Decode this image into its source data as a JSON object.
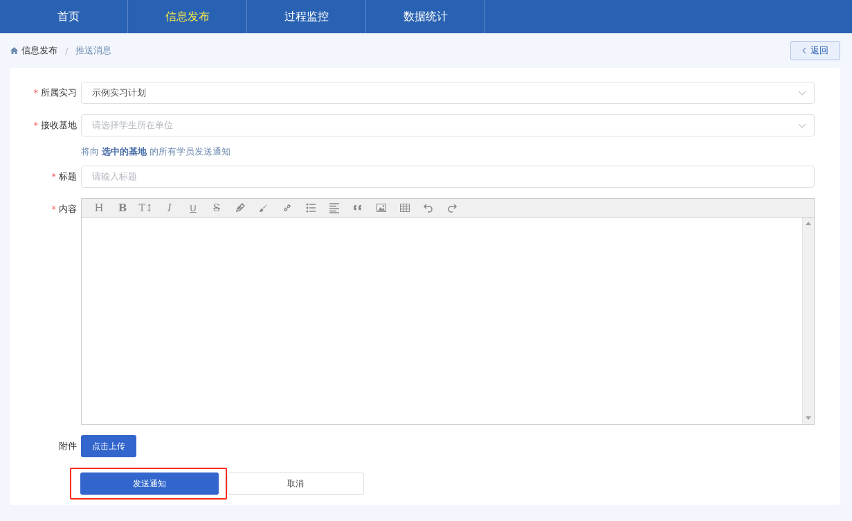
{
  "nav": [
    {
      "label": "首页",
      "selected": false
    },
    {
      "label": "信息发布",
      "selected": true
    },
    {
      "label": "过程监控",
      "selected": false
    },
    {
      "label": "数据统计",
      "selected": false
    }
  ],
  "breadcrumb": [
    "信息发布",
    "推送消息"
  ],
  "breadcrumb_separator": "/",
  "back_button": "返回",
  "form": {
    "fields": [
      {
        "label": "所属实习",
        "required_mark": "*",
        "kind": "select",
        "value": "示例实习计划"
      },
      {
        "label": "接收基地",
        "required_mark": "*",
        "kind": "select",
        "placeholder": "请选择学生所在单位",
        "hint": "将向 **选中的基地** 的所有学员发送通知"
      },
      {
        "label": "标题",
        "required_mark": "*",
        "kind": "input",
        "placeholder": "请输入标题"
      },
      {
        "label": "内容",
        "required_mark": "*",
        "kind": "editor"
      }
    ],
    "toolbar": [
      {
        "kind": "heading",
        "label": "H"
      },
      {
        "kind": "bold",
        "label": "B"
      },
      {
        "kind": "size",
        "label": "T↕"
      },
      {
        "kind": "italic",
        "label": "I"
      },
      {
        "kind": "underline",
        "label": "U"
      },
      {
        "kind": "strike",
        "label": "S"
      }
    ],
    "attachment": {
      "label": "附件",
      "button": "点击上传"
    },
    "buttons": [
      {
        "label": "发送通知",
        "kind": "primary",
        "highlighted": true
      },
      {
        "label": "取消",
        "kind": "plain",
        "highlighted": false
      }
    ]
  }
}
